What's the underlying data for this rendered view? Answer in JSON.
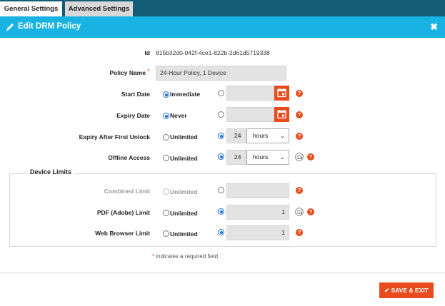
{
  "tabs": [
    {
      "label": "General Settings",
      "active": true
    },
    {
      "label": "Advanced Settings",
      "active": false
    }
  ],
  "header": {
    "title": "Edit DRM Policy",
    "close_symbol": "✖"
  },
  "form": {
    "id": {
      "label": "Id",
      "value": "815b32d0-042f-4ce1-822b-2d61d5719338"
    },
    "policy_name": {
      "label": "Policy Name",
      "required_marker": "*",
      "value": "24-Hour Policy, 1 Device"
    },
    "start_date": {
      "label": "Start Date",
      "option_label": "Immediate",
      "selected": "immediate",
      "value": ""
    },
    "expiry_date": {
      "label": "Expiry Date",
      "option_label": "Never",
      "selected": "never",
      "value": ""
    },
    "expiry_after_unlock": {
      "label": "Expiry After First Unlock",
      "option_label": "Unlimited",
      "selected": "custom",
      "number": "24",
      "unit": "hours"
    },
    "offline_access": {
      "label": "Offline Access",
      "option_label": "Unlimited",
      "selected": "custom",
      "number": "24",
      "unit": "hours"
    }
  },
  "device_limits": {
    "legend": "Device Limits",
    "combined": {
      "label": "Combined Limit",
      "option_label": "Unlimited",
      "selected": "none",
      "value": "",
      "disabled": true
    },
    "pdf": {
      "label": "PDF (Adobe) Limit",
      "option_label": "Unlimited",
      "selected": "custom",
      "value": "1"
    },
    "web": {
      "label": "Web Browser Limit",
      "option_label": "Unlimited",
      "selected": "custom",
      "value": "1"
    }
  },
  "help_glyph": "?",
  "required_note": {
    "star": "*",
    "text": " indicates a required field"
  },
  "save_button": {
    "icon": "✔",
    "label": "SAVE & EXIT"
  },
  "colors": {
    "accent": "#e84b1c",
    "header": "#18b3e3",
    "tabbar": "#135d76",
    "radio": "#1a73d9"
  }
}
